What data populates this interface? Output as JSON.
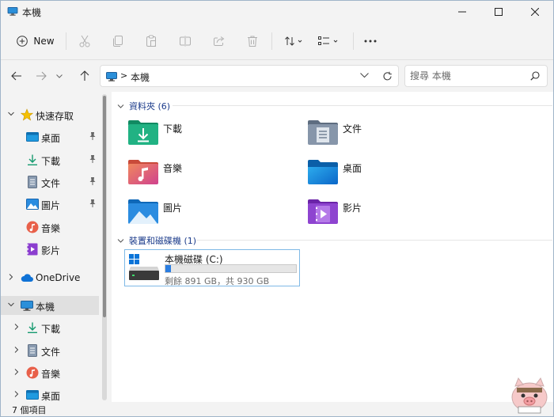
{
  "window": {
    "title": "本機",
    "minimize_label": "—",
    "colors": {
      "accent": "#2a7de1",
      "selected_row": "#e0e0e0",
      "group_header": "#1a3a8a"
    }
  },
  "toolbar": {
    "new_label": "New",
    "icons": [
      "cut-icon",
      "copy-icon",
      "paste-icon",
      "rename-icon",
      "share-icon",
      "delete-icon",
      "sort-icon",
      "view-icon",
      "more-icon"
    ]
  },
  "address": {
    "chevron": ">",
    "location": "本機"
  },
  "search": {
    "placeholder": "搜尋 本機"
  },
  "sidebar": {
    "items": [
      {
        "label": "快速存取",
        "icon": "star-icon",
        "expander": "open"
      },
      {
        "label": "桌面",
        "icon": "desktop-icon",
        "pinned": true
      },
      {
        "label": "下載",
        "icon": "download-icon",
        "pinned": true
      },
      {
        "label": "文件",
        "icon": "document-icon",
        "pinned": true
      },
      {
        "label": "圖片",
        "icon": "picture-icon",
        "pinned": true
      },
      {
        "label": "音樂",
        "icon": "music-icon",
        "pinned": false
      },
      {
        "label": "影片",
        "icon": "video-icon",
        "pinned": false
      },
      {
        "label": "OneDrive",
        "icon": "cloud-icon",
        "expander": "closed"
      },
      {
        "label": "本機",
        "icon": "pc-icon",
        "expander": "open",
        "selected": true
      },
      {
        "label": "下載",
        "icon": "download-icon",
        "expander": "closed"
      },
      {
        "label": "文件",
        "icon": "document-icon",
        "expander": "closed"
      },
      {
        "label": "音樂",
        "icon": "music-icon",
        "expander": "closed"
      },
      {
        "label": "桌面",
        "icon": "desktop-icon",
        "expander": "closed"
      }
    ]
  },
  "folders_group": {
    "label": "資料夾 (6)",
    "items": [
      {
        "label": "下載",
        "icon": "downloads-folder-icon"
      },
      {
        "label": "文件",
        "icon": "documents-folder-icon"
      },
      {
        "label": "音樂",
        "icon": "music-folder-icon"
      },
      {
        "label": "桌面",
        "icon": "desktop-folder-icon"
      },
      {
        "label": "圖片",
        "icon": "pictures-folder-icon"
      },
      {
        "label": "影片",
        "icon": "videos-folder-icon"
      }
    ]
  },
  "drives_group": {
    "label": "裝置和磁碟機 (1)",
    "drives": [
      {
        "name": "本機磁碟 (C:)",
        "free_text": "剩餘 891 GB，共 930 GB",
        "used_fraction": 0.042
      }
    ]
  },
  "status": {
    "item_count": "7 個項目"
  }
}
